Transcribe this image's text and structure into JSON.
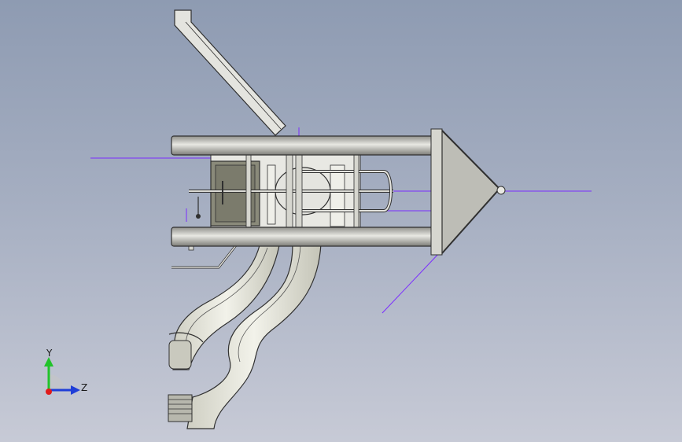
{
  "viewport": {
    "background_top": "#8e9bb2",
    "background_bottom": "#c7cad6"
  },
  "model": {
    "icon": "playground-slide-assembly",
    "part_fill": "#e4e4df",
    "outline_color": "#303030",
    "panel_fill": "#8a8a7a",
    "sketch_line_color": "#7a2cff"
  },
  "triad": {
    "y_label": "Y",
    "z_label": "Z",
    "y_color": "#21c32a",
    "z_color": "#1f3ed8",
    "x_color": "#e01b1b"
  }
}
